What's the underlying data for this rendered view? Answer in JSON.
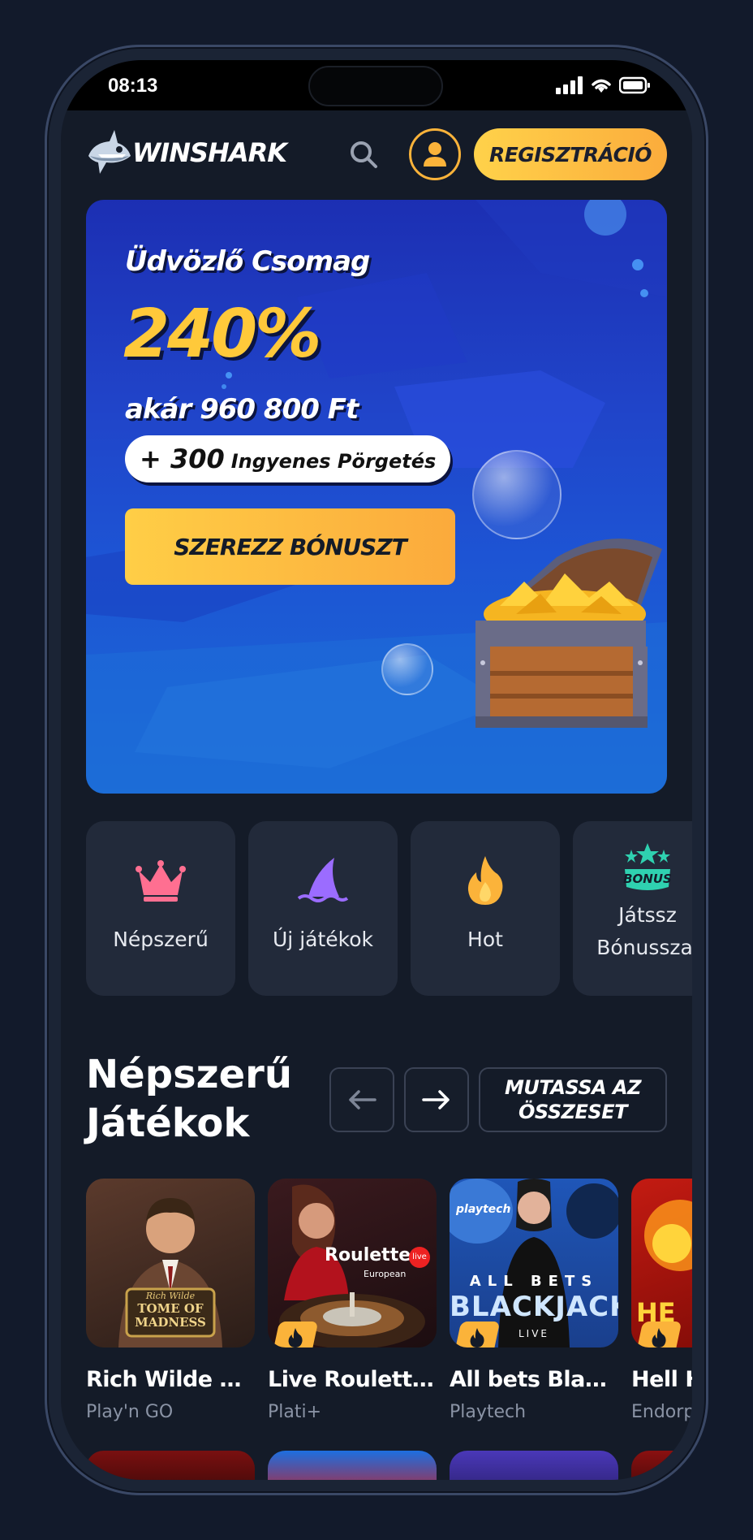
{
  "status_bar": {
    "time": "08:13"
  },
  "header": {
    "logo_text": "WINSHARK",
    "register_label": "REGISZTRÁCIÓ"
  },
  "hero": {
    "title": "Üdvözlő Csomag",
    "percent": "240%",
    "amount": "akár 960 800 Ft",
    "spins_number": "+ 300",
    "spins_text": "Ingyenes Pörgetés",
    "cta_label": "SZEREZZ BÓNUSZT"
  },
  "categories": [
    {
      "label": "Népszerű",
      "icon": "crown-icon"
    },
    {
      "label": "Új játékok",
      "icon": "shark-fin-icon"
    },
    {
      "label": "Hot",
      "icon": "flame-icon"
    },
    {
      "label": "Játssz Bónusszal",
      "icon": "bonus-icon"
    }
  ],
  "popular": {
    "title_line1": "Népszerű",
    "title_line2": "Játékok",
    "show_all_line1": "MUTASSA AZ",
    "show_all_line2": "ÖSSZESET"
  },
  "games": [
    {
      "name": "Rich Wilde and...",
      "provider": "Play'n GO",
      "thumb_text1": "Rich Wilde",
      "thumb_text2": "TOME OF MADNESS",
      "hot": false
    },
    {
      "name": "Live Roulette E...",
      "provider": "Plati+",
      "thumb_text1": "Roulette",
      "thumb_text2": "European",
      "thumb_badge": "live",
      "hot": true
    },
    {
      "name": "All bets Blackj...",
      "provider": "Playtech",
      "thumb_text1": "BLACKJACK",
      "thumb_text2": "LIVE",
      "thumb_text3": "playtech",
      "thumb_text4": "ALL BETS",
      "hot": true
    },
    {
      "name": "Hell Hot",
      "provider": "Endorphina",
      "thumb_text1": "HE",
      "hot": true
    }
  ],
  "colors": {
    "accent": "#fbb33a",
    "background": "#141b28",
    "card": "#222a3a"
  }
}
